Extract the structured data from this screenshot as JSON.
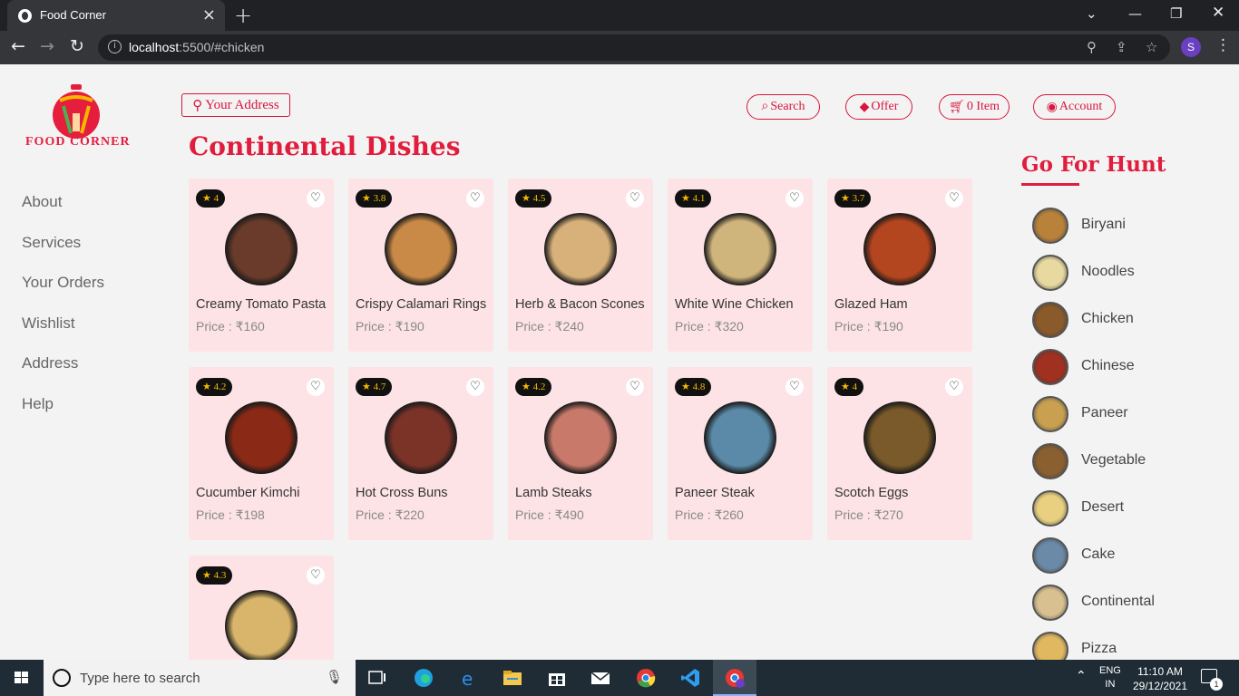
{
  "browser": {
    "tab_title": "Food Corner",
    "url_host": "localhost",
    "url_rest": ":5500/#chicken",
    "profile_initial": "S"
  },
  "site": {
    "logo_text": "FOOD CORNER",
    "address_button": "Your Address",
    "header_buttons": [
      "Search",
      "Offer",
      "0 Item",
      "Account"
    ],
    "side_nav": [
      "About",
      "Services",
      "Your Orders",
      "Wishlist",
      "Address",
      "Help"
    ]
  },
  "main": {
    "title": "Continental Dishes",
    "price_prefix": "Price : ₹",
    "dishes": [
      {
        "name": "Creamy Tomato Pasta",
        "price": "160",
        "rating": "4",
        "color": "#6a3b2a"
      },
      {
        "name": "Crispy Calamari Rings",
        "price": "190",
        "rating": "3.8",
        "color": "#c98a47"
      },
      {
        "name": "Herb & Bacon Scones",
        "price": "240",
        "rating": "4.5",
        "color": "#d7b07a"
      },
      {
        "name": "White Wine Chicken",
        "price": "320",
        "rating": "4.1",
        "color": "#cfb47c"
      },
      {
        "name": "Glazed Ham",
        "price": "190",
        "rating": "3.7",
        "color": "#b4461f"
      },
      {
        "name": "Cucumber Kimchi",
        "price": "198",
        "rating": "4.2",
        "color": "#8a2a16"
      },
      {
        "name": "Hot Cross Buns",
        "price": "220",
        "rating": "4.7",
        "color": "#7b3328"
      },
      {
        "name": "Lamb Steaks",
        "price": "490",
        "rating": "4.2",
        "color": "#c8796a"
      },
      {
        "name": "Paneer Steak",
        "price": "260",
        "rating": "4.8",
        "color": "#5a8aa8"
      },
      {
        "name": "Scotch Eggs",
        "price": "270",
        "rating": "4",
        "color": "#7a5a2a"
      },
      {
        "name": "",
        "price": "",
        "rating": "4.3",
        "color": "#d8b56a"
      }
    ]
  },
  "hunt": {
    "title": "Go For Hunt",
    "categories": [
      {
        "label": "Biryani",
        "color": "#b8823a"
      },
      {
        "label": "Noodles",
        "color": "#e8d9a0"
      },
      {
        "label": "Chicken",
        "color": "#8a5a2a"
      },
      {
        "label": "Chinese",
        "color": "#a03020"
      },
      {
        "label": "Paneer",
        "color": "#c8a050"
      },
      {
        "label": "Vegetable",
        "color": "#8a6030"
      },
      {
        "label": "Desert",
        "color": "#e8d080"
      },
      {
        "label": "Cake",
        "color": "#6a8aa8"
      },
      {
        "label": "Continental",
        "color": "#d8c090"
      },
      {
        "label": "Pizza",
        "color": "#e0b860"
      }
    ]
  },
  "taskbar": {
    "search_placeholder": "Type here to search",
    "lang_top": "ENG",
    "lang_bottom": "IN",
    "time": "11:10 AM",
    "date": "29/12/2021",
    "notif_count": "1"
  }
}
